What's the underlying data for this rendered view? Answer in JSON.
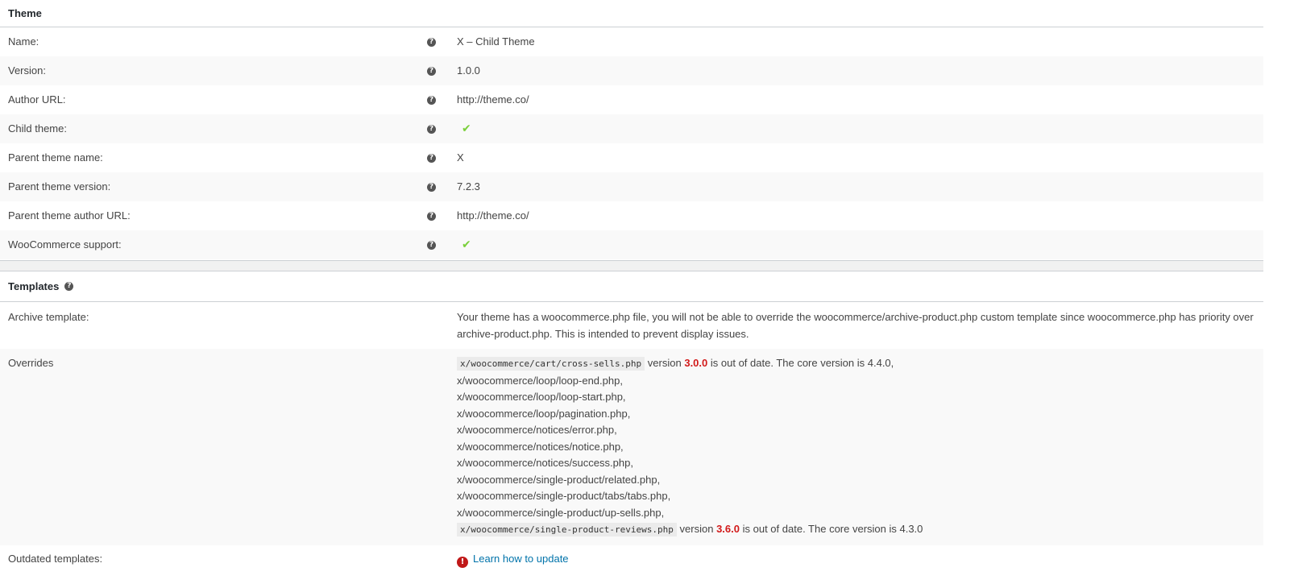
{
  "theme": {
    "title": "Theme",
    "rows": [
      {
        "label": "Name:",
        "value": "X – Child Theme"
      },
      {
        "label": "Version:",
        "value": "1.0.0"
      },
      {
        "label": "Author URL:",
        "value": "http://theme.co/"
      },
      {
        "label": "Child theme:",
        "value": "✔"
      },
      {
        "label": "Parent theme name:",
        "value": "X"
      },
      {
        "label": "Parent theme version:",
        "value": "7.2.3"
      },
      {
        "label": "Parent theme author URL:",
        "value": "http://theme.co/"
      },
      {
        "label": "WooCommerce support:",
        "value": "✔"
      }
    ]
  },
  "templates": {
    "title": "Templates",
    "archive_label": "Archive template:",
    "archive_text": "Your theme has a woocommerce.php file, you will not be able to override the woocommerce/archive-product.php custom template since woocommerce.php has priority over archive-product.php. This is intended to prevent display issues.",
    "overrides_label": "Overrides",
    "override_first": {
      "file": "x/woocommerce/cart/cross-sells.php",
      "pre": "version",
      "version": "3.0.0",
      "post": "is out of date. The core version is 4.4.0,"
    },
    "override_lines": [
      "x/woocommerce/loop/loop-end.php,",
      "x/woocommerce/loop/loop-start.php,",
      "x/woocommerce/loop/pagination.php,",
      "x/woocommerce/notices/error.php,",
      "x/woocommerce/notices/notice.php,",
      "x/woocommerce/notices/success.php,",
      "x/woocommerce/single-product/related.php,",
      "x/woocommerce/single-product/tabs/tabs.php,",
      "x/woocommerce/single-product/up-sells.php,"
    ],
    "override_last": {
      "file": "x/woocommerce/single-product-reviews.php",
      "pre": "version",
      "version": "3.6.0",
      "post": "is out of date. The core version is 4.3.0"
    },
    "outdated_label": "Outdated templates:",
    "outdated_link": "Learn how to update"
  },
  "icons": {
    "help": "help-icon",
    "check": "check-icon",
    "error": "error-icon"
  },
  "colors": {
    "check": "#7ad03a",
    "outdated": "#d21a1a",
    "link": "#0073aa",
    "error_icon": "#c01818"
  }
}
